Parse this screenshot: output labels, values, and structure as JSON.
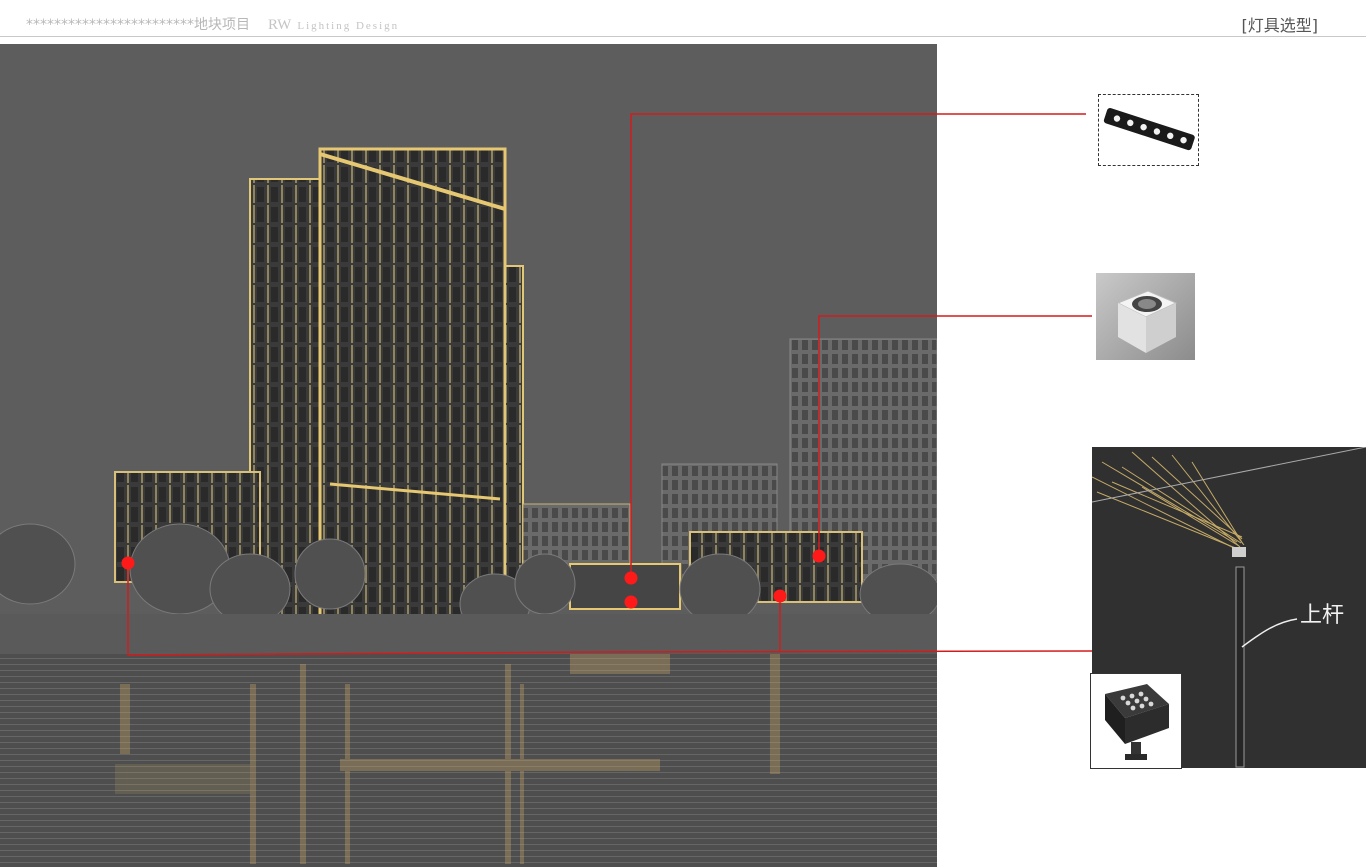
{
  "header": {
    "project": "************************地块项目",
    "brand": "RW",
    "tagline": "Lighting Design",
    "section": "[灯具选型]"
  },
  "sketch": {
    "annotation": "上杆"
  },
  "colors": {
    "leader_line": "#d21c1c",
    "marker": "#ff1a1a",
    "glow": "#e6c872",
    "background": "#5b5b5b"
  },
  "fixtures": [
    {
      "id": "led-line-washer",
      "icon": "linear-led-fixture-icon"
    },
    {
      "id": "square-spot",
      "icon": "square-spotlight-icon"
    },
    {
      "id": "pole-floodlight",
      "icon": "pole-sketch-icon"
    },
    {
      "id": "square-floodlight",
      "icon": "floodlight-icon"
    }
  ]
}
